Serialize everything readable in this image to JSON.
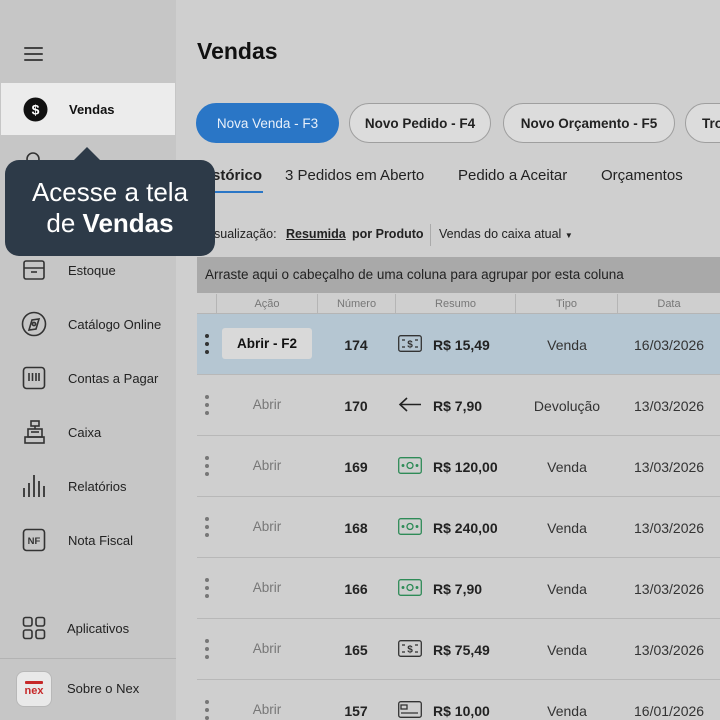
{
  "sidebar": {
    "items": [
      {
        "label": "Vendas",
        "icon": "dollar-circle-icon"
      },
      {
        "label": "Estoque",
        "icon": "stock-box-icon"
      },
      {
        "label": "Catálogo Online",
        "icon": "catalog-icon"
      },
      {
        "label": "Contas a Pagar",
        "icon": "bills-icon"
      },
      {
        "label": "Caixa",
        "icon": "cash-register-icon"
      },
      {
        "label": "Relatórios",
        "icon": "reports-icon"
      },
      {
        "label": "Nota Fiscal",
        "icon": "nf-icon"
      },
      {
        "label": "Aplicativos",
        "icon": "apps-grid-icon"
      },
      {
        "label": "Sobre o Nex",
        "icon": "nex-logo-icon"
      }
    ],
    "logo_text": "nex"
  },
  "tooltip": {
    "line1": "Acesse a tela",
    "line2_prefix": "de ",
    "line2_bold": "Vendas"
  },
  "main": {
    "title": "Vendas",
    "actions": [
      "Nova Venda - F3",
      "Novo Pedido - F4",
      "Novo Orçamento - F5",
      "Tro"
    ],
    "tabs": [
      "stórico",
      "3 Pedidos em Aberto",
      "Pedido a Aceitar",
      "Orçamentos"
    ],
    "filters": {
      "label": "sualização:",
      "option_selected": "Resumida",
      "option_other": "por Produto",
      "dropdown": "Vendas do caixa atual"
    },
    "group_hint": "Arraste aqui o cabeçalho de uma coluna para agrupar por esta coluna",
    "columns": [
      "Ação",
      "Número",
      "Resumo",
      "Tipo",
      "Data"
    ],
    "rows": [
      {
        "action": "Abrir - F2",
        "number": "174",
        "icon": "cash-note-icon",
        "value": "R$ 15,49",
        "type": "Venda",
        "date": "16/03/2026"
      },
      {
        "action": "Abrir",
        "number": "170",
        "icon": "arrow-left-icon",
        "value": "R$ 7,90",
        "type": "Devolução",
        "date": "13/03/2026"
      },
      {
        "action": "Abrir",
        "number": "169",
        "icon": "banknote-icon",
        "value": "R$ 120,00",
        "type": "Venda",
        "date": "13/03/2026"
      },
      {
        "action": "Abrir",
        "number": "168",
        "icon": "banknote-icon",
        "value": "R$ 240,00",
        "type": "Venda",
        "date": "13/03/2026"
      },
      {
        "action": "Abrir",
        "number": "166",
        "icon": "banknote-icon",
        "value": "R$ 7,90",
        "type": "Venda",
        "date": "13/03/2026"
      },
      {
        "action": "Abrir",
        "number": "165",
        "icon": "cash-note-icon",
        "value": "R$ 75,49",
        "type": "Venda",
        "date": "13/03/2026"
      },
      {
        "action": "Abrir",
        "number": "157",
        "icon": "card-icon",
        "value": "R$ 10,00",
        "type": "Venda",
        "date": "16/01/2026"
      }
    ]
  },
  "colors": {
    "primary": "#2a76c6",
    "tooltip_bg": "#2d3a48",
    "highlight_row": "#b5c6d2",
    "money_green": "#2e8b57"
  }
}
